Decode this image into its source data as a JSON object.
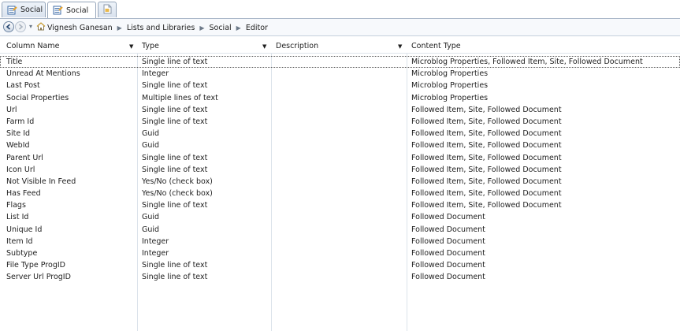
{
  "tabs": [
    {
      "label": "Social",
      "state": "inactive"
    },
    {
      "label": "Social",
      "state": "active"
    },
    {
      "label": "",
      "state": "new"
    }
  ],
  "nav": {
    "back": "back",
    "forward": "forward",
    "breadcrumbs": [
      "Vignesh Ganesan",
      "Lists and Libraries",
      "Social",
      "Editor"
    ]
  },
  "columns": {
    "name": "Column Name",
    "type": "Type",
    "description": "Description",
    "content_type": "Content Type"
  },
  "rows": [
    {
      "name": "Title",
      "type": "Single line of text",
      "description": "",
      "content_type": "Microblog Properties, Followed Item, Site, Followed Document"
    },
    {
      "name": "Unread At Mentions",
      "type": "Integer",
      "description": "",
      "content_type": "Microblog Properties"
    },
    {
      "name": "Last Post",
      "type": "Single line of text",
      "description": "",
      "content_type": "Microblog Properties"
    },
    {
      "name": "Social Properties",
      "type": "Multiple lines of text",
      "description": "",
      "content_type": "Microblog Properties"
    },
    {
      "name": "Url",
      "type": "Single line of text",
      "description": "",
      "content_type": "Followed Item, Site, Followed Document"
    },
    {
      "name": "Farm Id",
      "type": "Single line of text",
      "description": "",
      "content_type": "Followed Item, Site, Followed Document"
    },
    {
      "name": "Site Id",
      "type": "Guid",
      "description": "",
      "content_type": "Followed Item, Site, Followed Document"
    },
    {
      "name": "WebId",
      "type": "Guid",
      "description": "",
      "content_type": "Followed Item, Site, Followed Document"
    },
    {
      "name": "Parent Url",
      "type": "Single line of text",
      "description": "",
      "content_type": "Followed Item, Site, Followed Document"
    },
    {
      "name": "Icon Url",
      "type": "Single line of text",
      "description": "",
      "content_type": "Followed Item, Site, Followed Document"
    },
    {
      "name": "Not Visible In Feed",
      "type": "Yes/No (check box)",
      "description": "",
      "content_type": "Followed Item, Site, Followed Document"
    },
    {
      "name": "Has Feed",
      "type": "Yes/No (check box)",
      "description": "",
      "content_type": "Followed Item, Site, Followed Document"
    },
    {
      "name": "Flags",
      "type": "Single line of text",
      "description": "",
      "content_type": "Followed Item, Site, Followed Document"
    },
    {
      "name": "List Id",
      "type": "Guid",
      "description": "",
      "content_type": "Followed Document"
    },
    {
      "name": "Unique Id",
      "type": "Guid",
      "description": "",
      "content_type": "Followed Document"
    },
    {
      "name": "Item Id",
      "type": "Integer",
      "description": "",
      "content_type": "Followed Document"
    },
    {
      "name": "Subtype",
      "type": "Integer",
      "description": "",
      "content_type": "Followed Document"
    },
    {
      "name": "File Type ProgID",
      "type": "Single line of text",
      "description": "",
      "content_type": "Followed Document"
    },
    {
      "name": "Server Url ProgID",
      "type": "Single line of text",
      "description": "",
      "content_type": "Followed Document"
    }
  ],
  "colors": {
    "accent": "#2f6fbf",
    "selection_outline": "#555555",
    "grid": "#dce3eb"
  }
}
